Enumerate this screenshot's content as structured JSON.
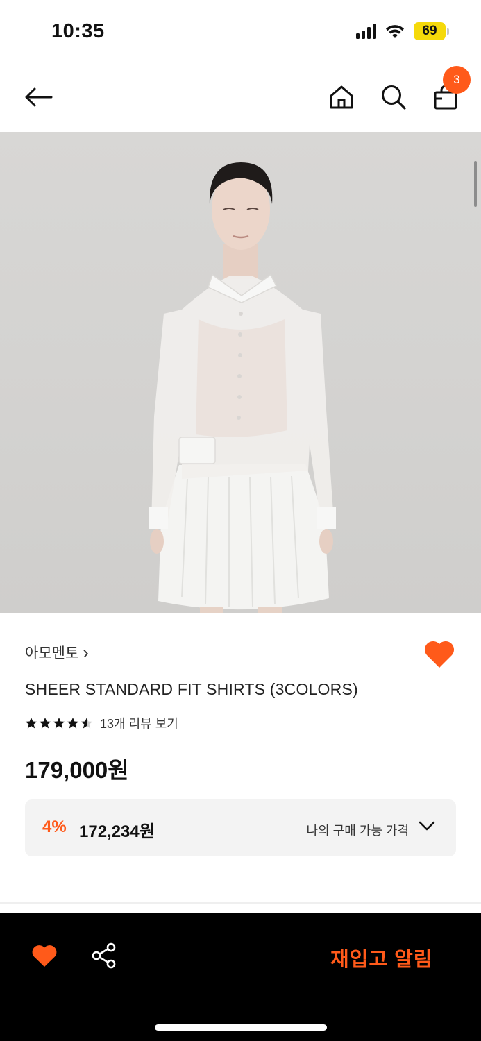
{
  "status_bar": {
    "time": "10:35",
    "battery": "69",
    "icons": [
      "signal-icon",
      "wifi-icon",
      "battery-icon"
    ]
  },
  "header": {
    "icons": [
      "back-arrow-icon",
      "home-icon",
      "search-icon",
      "shopping-bag-icon"
    ],
    "cart_count": "3"
  },
  "product": {
    "image_icon": "product-photo",
    "brand": "아모멘토",
    "brand_chevron": "›",
    "name": "SHEER STANDARD FIT SHIRTS (3COLORS)",
    "rating": 4.5,
    "rating_max": 5,
    "review_link": "13개 리뷰 보기",
    "price": "179,000원",
    "wishlisted": true
  },
  "discount": {
    "rate": "4%",
    "price": "172,234원",
    "label": "나의 구매 가능 가격"
  },
  "bottom_bar": {
    "restock_label": "재입고 알림",
    "icons": [
      "heart-icon",
      "share-icon"
    ]
  },
  "colors": {
    "accent": "#ff5a1a",
    "bottom_bar_bg": "#000000",
    "discount_box_bg": "#f3f3f3",
    "battery_fill": "#f5d90a"
  }
}
